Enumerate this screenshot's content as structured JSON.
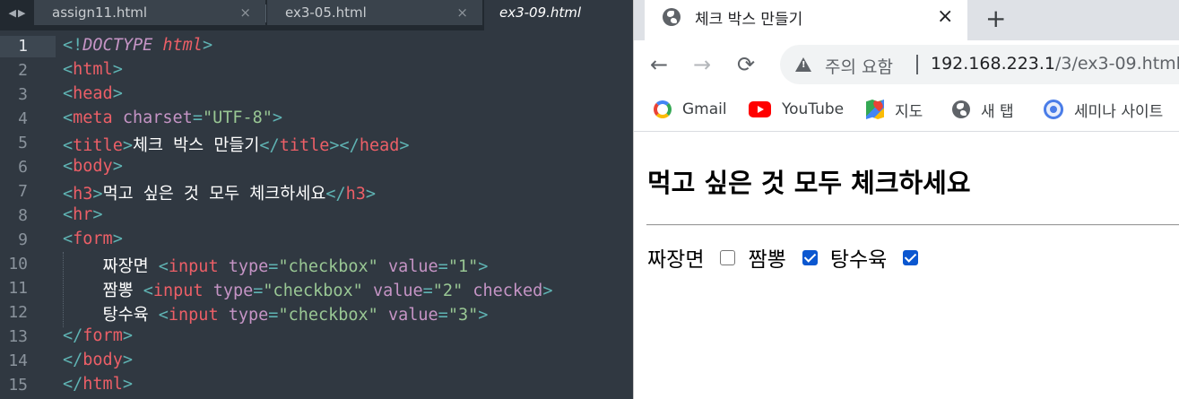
{
  "editor": {
    "tabs": [
      {
        "label": "assign11.html",
        "close": "×"
      },
      {
        "label": "ex3-05.html",
        "close": "×"
      },
      {
        "label": "ex3-09.html"
      }
    ],
    "active_line": 1,
    "lines": [
      {
        "n": "1",
        "segs": [
          [
            "p",
            "<!"
          ],
          [
            "a ital",
            "DOCTYPE"
          ],
          [
            "w",
            " "
          ],
          [
            "t ital",
            "html"
          ],
          [
            "p",
            ">"
          ]
        ]
      },
      {
        "n": "2",
        "segs": [
          [
            "p",
            "<"
          ],
          [
            "t",
            "html"
          ],
          [
            "p",
            ">"
          ]
        ]
      },
      {
        "n": "3",
        "segs": [
          [
            "p",
            "<"
          ],
          [
            "t",
            "head"
          ],
          [
            "p",
            ">"
          ]
        ]
      },
      {
        "n": "4",
        "segs": [
          [
            "p",
            "<"
          ],
          [
            "t",
            "meta"
          ],
          [
            "w",
            " "
          ],
          [
            "a",
            "charset"
          ],
          [
            "p",
            "="
          ],
          [
            "s",
            "\"UTF-8\""
          ],
          [
            "p",
            ">"
          ]
        ]
      },
      {
        "n": "5",
        "segs": [
          [
            "p",
            "<"
          ],
          [
            "t",
            "title"
          ],
          [
            "p",
            ">"
          ],
          [
            "w",
            "체크 박스 만들기"
          ],
          [
            "p",
            "</"
          ],
          [
            "t",
            "title"
          ],
          [
            "p",
            "></"
          ],
          [
            "t",
            "head"
          ],
          [
            "p",
            ">"
          ]
        ]
      },
      {
        "n": "6",
        "segs": [
          [
            "p",
            "<"
          ],
          [
            "t",
            "body"
          ],
          [
            "p",
            ">"
          ]
        ]
      },
      {
        "n": "7",
        "segs": [
          [
            "p",
            "<"
          ],
          [
            "t",
            "h3"
          ],
          [
            "p",
            ">"
          ],
          [
            "w",
            "먹고 싶은 것 모두 체크하세요"
          ],
          [
            "p",
            "</"
          ],
          [
            "t",
            "h3"
          ],
          [
            "p",
            ">"
          ]
        ]
      },
      {
        "n": "8",
        "segs": [
          [
            "p",
            "<"
          ],
          [
            "t",
            "hr"
          ],
          [
            "p",
            ">"
          ]
        ]
      },
      {
        "n": "9",
        "segs": [
          [
            "p",
            "<"
          ],
          [
            "t",
            "form"
          ],
          [
            "p",
            ">"
          ]
        ]
      },
      {
        "n": "10",
        "segs": [
          [
            "w",
            "    짜장면 "
          ],
          [
            "p",
            "<"
          ],
          [
            "t",
            "input"
          ],
          [
            "w",
            " "
          ],
          [
            "a",
            "type"
          ],
          [
            "p",
            "="
          ],
          [
            "s",
            "\"checkbox\""
          ],
          [
            "w",
            " "
          ],
          [
            "a",
            "value"
          ],
          [
            "p",
            "="
          ],
          [
            "s",
            "\"1\""
          ],
          [
            "p",
            ">"
          ]
        ]
      },
      {
        "n": "11",
        "segs": [
          [
            "w",
            "    짬뽕 "
          ],
          [
            "p",
            "<"
          ],
          [
            "t",
            "input"
          ],
          [
            "w",
            " "
          ],
          [
            "a",
            "type"
          ],
          [
            "p",
            "="
          ],
          [
            "s",
            "\"checkbox\""
          ],
          [
            "w",
            " "
          ],
          [
            "a",
            "value"
          ],
          [
            "p",
            "="
          ],
          [
            "s",
            "\"2\""
          ],
          [
            "w",
            " "
          ],
          [
            "a",
            "checked"
          ],
          [
            "p",
            ">"
          ]
        ]
      },
      {
        "n": "12",
        "segs": [
          [
            "w",
            "    탕수육 "
          ],
          [
            "p",
            "<"
          ],
          [
            "t",
            "input"
          ],
          [
            "w",
            " "
          ],
          [
            "a",
            "type"
          ],
          [
            "p",
            "="
          ],
          [
            "s",
            "\"checkbox\""
          ],
          [
            "w",
            " "
          ],
          [
            "a",
            "value"
          ],
          [
            "p",
            "="
          ],
          [
            "s",
            "\"3\""
          ],
          [
            "p",
            ">"
          ]
        ]
      },
      {
        "n": "13",
        "segs": [
          [
            "p",
            "</"
          ],
          [
            "t",
            "form"
          ],
          [
            "p",
            ">"
          ]
        ]
      },
      {
        "n": "14",
        "segs": [
          [
            "p",
            "</"
          ],
          [
            "t",
            "body"
          ],
          [
            "p",
            ">"
          ]
        ]
      },
      {
        "n": "15",
        "segs": [
          [
            "p",
            "</"
          ],
          [
            "t",
            "html"
          ],
          [
            "p",
            ">"
          ]
        ]
      }
    ],
    "colors": {
      "background": "#303841",
      "tag": "#ec5f67",
      "punct": "#5fb3b3",
      "attr": "#c594c5",
      "string": "#99c794"
    }
  },
  "browser": {
    "tab": {
      "title": "체크 박스 만들기",
      "close": "×",
      "icon": "globe-icon"
    },
    "new_tab": "+",
    "nav": {
      "back": "←",
      "forward": "→",
      "reload": "⟳"
    },
    "omnibox": {
      "security": "주의 요함",
      "host": "192.168.223.1",
      "path": "/3/ex3-09.html"
    },
    "bookmarks": [
      {
        "label": "Gmail",
        "icon": "google-icon"
      },
      {
        "label": "YouTube",
        "icon": "youtube-icon"
      },
      {
        "label": "지도",
        "icon": "maps-icon"
      },
      {
        "label": "새 탭",
        "icon": "globe-icon"
      },
      {
        "label": "세미나 사이트",
        "icon": "target-icon"
      }
    ],
    "page": {
      "heading": "먹고 싶은 것 모두 체크하세요",
      "options": [
        {
          "label": "짜장면",
          "checked": false
        },
        {
          "label": "짬뽕",
          "checked": true
        },
        {
          "label": "탕수육",
          "checked": true
        }
      ],
      "accent": "#0b57d0"
    }
  }
}
